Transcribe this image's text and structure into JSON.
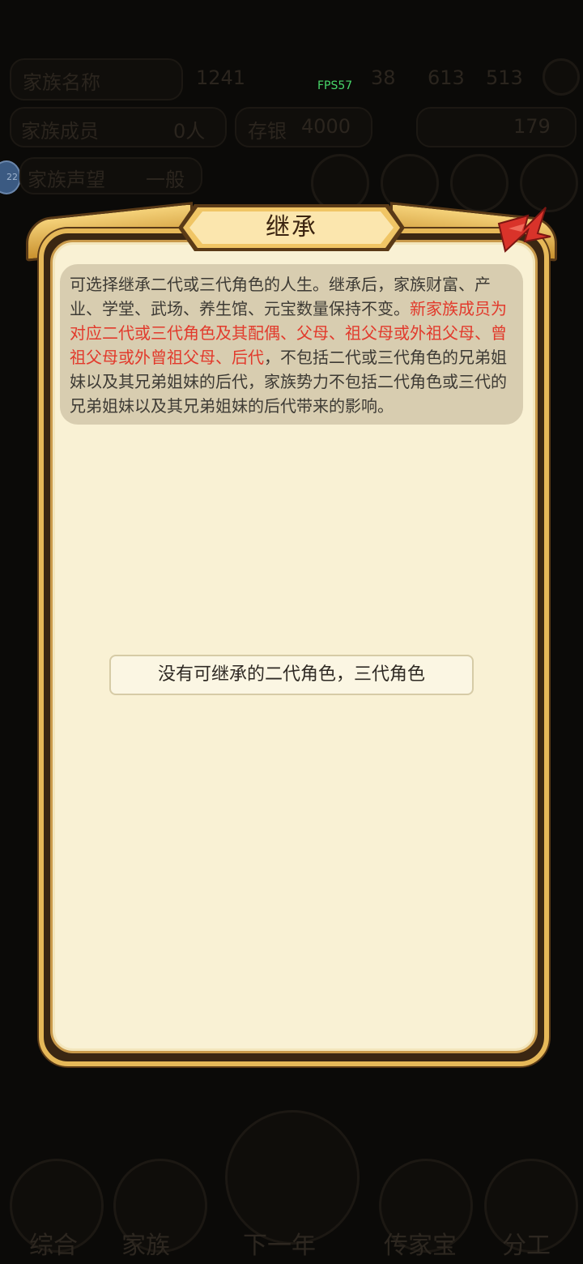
{
  "overlay": {
    "fps_label": "FPS57"
  },
  "background": {
    "top_bar": {
      "family_name": "家族名称",
      "resource_value": "1241",
      "stat_a": "38",
      "stat_b": "613",
      "stat_c": "513"
    },
    "row_two": {
      "members_label": "家族成员",
      "members_value": "0人",
      "assets_label": "存银",
      "assets_value": "4000",
      "coins_value": "179"
    },
    "avatar_badge": "22",
    "row_three_label": "家族声望",
    "row_three_value": "一般",
    "bottom_nav": [
      "综合",
      "家族",
      "下一年",
      "传家宝",
      "分工"
    ]
  },
  "dialog": {
    "title": "继承",
    "description_normal_1": "可选择继承二代或三代角色的人生。继承后，家族财富、产业、学堂、武场、养生馆、元宝数量保持不变。",
    "description_highlight": "新家族成员为对应二代或三代角色及其配偶、父母、祖父母或外祖父母、曾祖父母或外曾祖父母、后代",
    "description_normal_2": "，不包括二代或三代角色的兄弟姐妹以及其兄弟姐妹的后代，家族势力不包括二代角色或三代的兄弟姐妹以及其兄弟姐妹的后代带来的影响。",
    "empty_message": "没有可继承的二代角色，三代角色",
    "highlight_color": "#e23a2c",
    "panel_color": "#f9f1d4",
    "frame_color": "#e6b858",
    "close_icon": "close-ribbon-icon"
  }
}
